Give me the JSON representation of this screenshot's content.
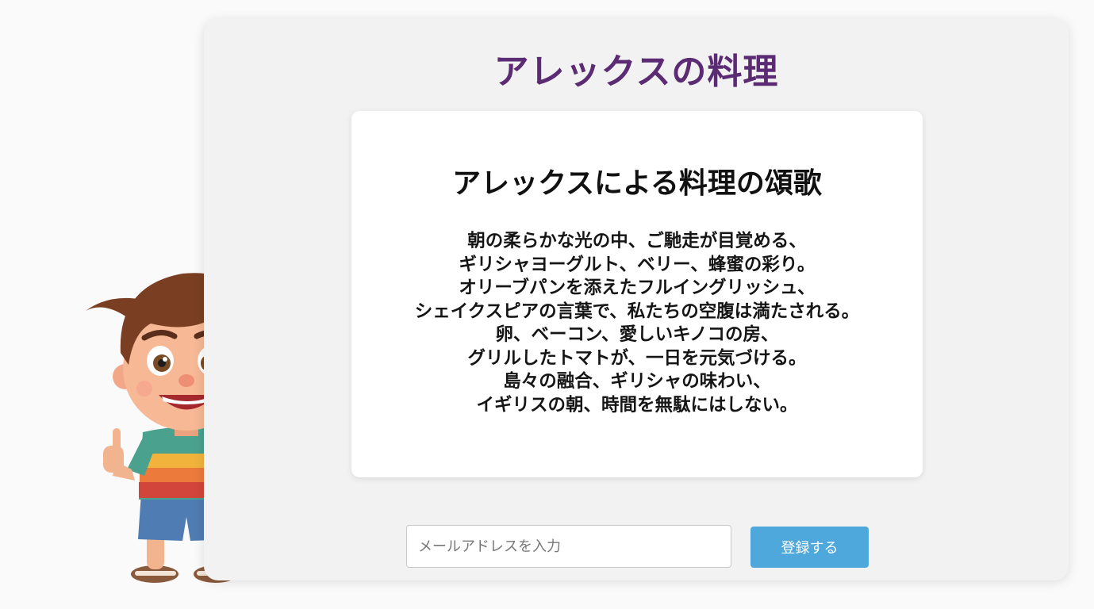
{
  "site": {
    "title": "アレックスの料理"
  },
  "poem": {
    "title": "アレックスによる料理の頌歌",
    "lines": [
      "朝の柔らかな光の中、ご馳走が目覚める、",
      "ギリシャヨーグルト、ベリー、蜂蜜の彩り。",
      "オリーブパンを添えたフルイングリッシュ、",
      "シェイクスピアの言葉で、私たちの空腹は満たされる。",
      "卵、ベーコン、愛しいキノコの房、",
      "グリルしたトマトが、一日を元気づける。",
      "島々の融合、ギリシャの味わい、",
      "イギリスの朝、時間を無駄にはしない。"
    ]
  },
  "signup": {
    "email_placeholder": "メールアドレスを入力",
    "email_value": "",
    "submit_label": "登録する"
  },
  "mascot": {
    "icon": "cartoon-boy-thumbs-up"
  },
  "colors": {
    "title": "#5b2b73",
    "button": "#4ea8dc"
  }
}
